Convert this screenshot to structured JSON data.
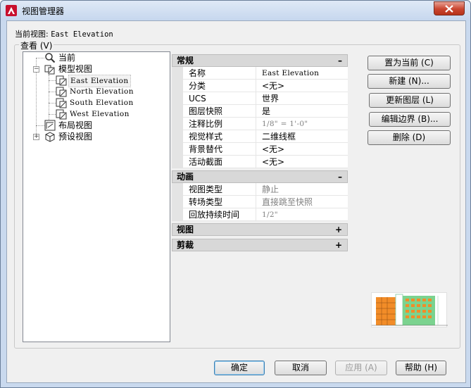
{
  "window": {
    "title": "视图管理器"
  },
  "current_view": {
    "label": "当前视图:",
    "value": "East Elevation"
  },
  "group": {
    "label": "查看 (V)"
  },
  "tree": {
    "current": "当前",
    "model_views": "模型视图",
    "views": [
      "East Elevation",
      "North Elevation",
      "South Elevation",
      "West Elevation"
    ],
    "layout_views": "布局视图",
    "preset_views": "预设视图"
  },
  "properties": {
    "general": {
      "header": "常规",
      "rows": [
        {
          "name": "名称",
          "value": "East Elevation"
        },
        {
          "name": "分类",
          "value": "<无>"
        },
        {
          "name": "UCS",
          "value": "世界"
        },
        {
          "name": "图层快照",
          "value": "是"
        },
        {
          "name": "注释比例",
          "value": "1/8\" = 1'-0\""
        },
        {
          "name": "视觉样式",
          "value": "二维线框"
        },
        {
          "name": "背景替代",
          "value": "<无>"
        },
        {
          "name": "活动截面",
          "value": "<无>"
        }
      ]
    },
    "animation": {
      "header": "动画",
      "rows": [
        {
          "name": "视图类型",
          "value": "静止"
        },
        {
          "name": "转场类型",
          "value": "直接跳至快照"
        },
        {
          "name": "回放持续时间",
          "value": "1/2\""
        }
      ]
    },
    "view": {
      "header": "视图"
    },
    "clip": {
      "header": "剪裁"
    },
    "collapse_glyph": "–",
    "expand_glyph": "+"
  },
  "buttons": {
    "set_current": "置为当前 (C)",
    "new": "新建 (N)...",
    "update_layers": "更新图层 (L)",
    "edit_boundaries": "编辑边界 (B)...",
    "delete": "删除 (D)",
    "ok": "确定",
    "cancel": "取消",
    "apply": "应用 (A)",
    "help": "帮助 (H)"
  },
  "colors": {
    "accent_red": "#c8102e",
    "preview_orange": "#f28c28",
    "preview_green": "#7bd38f"
  }
}
